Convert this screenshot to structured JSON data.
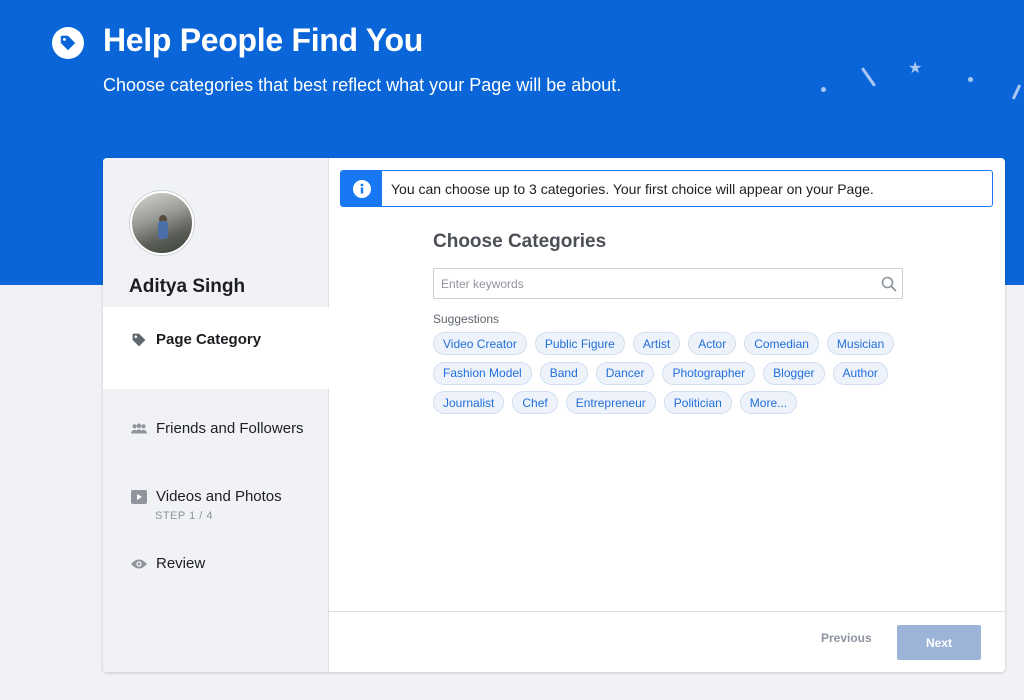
{
  "header": {
    "title": "Help People Find You",
    "subtitle": "Choose categories that best reflect what your Page will be about.",
    "icon": "tag-icon"
  },
  "sidebar": {
    "user_name": "Aditya Singh",
    "steps": [
      {
        "label": "Page Category",
        "sub": "STEP 1 / 4",
        "icon": "tag-icon"
      },
      {
        "label": "Friends and Followers",
        "icon": "people-icon"
      },
      {
        "label": "Videos and Photos",
        "icon": "video-icon"
      },
      {
        "label": "Review",
        "icon": "eye-icon"
      }
    ]
  },
  "main": {
    "notice": "You can choose up to 3 categories. Your first choice will appear on your Page.",
    "section_title": "Choose Categories",
    "search_placeholder": "Enter keywords",
    "search_value": "",
    "suggestions_label": "Suggestions",
    "suggestions": [
      [
        "Video Creator",
        "Public Figure",
        "Artist",
        "Actor",
        "Comedian",
        "Musician"
      ],
      [
        "Fashion Model",
        "Band",
        "Dancer",
        "Photographer",
        "Blogger",
        "Author"
      ],
      [
        "Journalist",
        "Chef",
        "Entrepreneur",
        "Politician",
        "More..."
      ]
    ]
  },
  "footer": {
    "previous_label": "Previous",
    "next_label": "Next"
  },
  "colors": {
    "brand": "#0a66d8",
    "accent": "#1877f2",
    "chip_text": "#216fdb",
    "next_disabled": "#9cb4d8"
  }
}
